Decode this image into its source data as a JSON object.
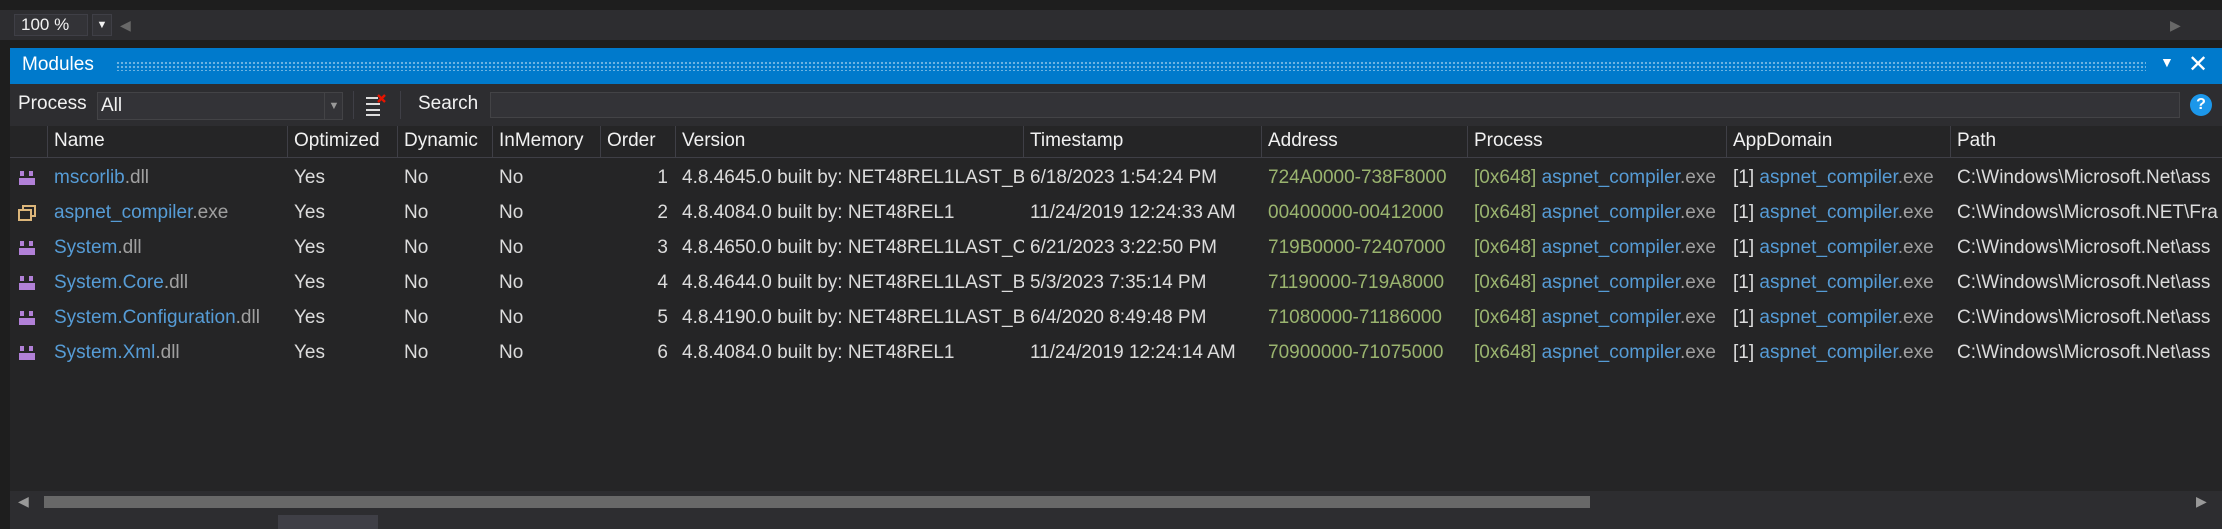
{
  "zoom": {
    "value": "100 %"
  },
  "panel": {
    "title": "Modules"
  },
  "toolbar": {
    "process_label": "Process",
    "process_value": "All",
    "search_label": "Search",
    "search_value": ""
  },
  "columns": [
    "Name",
    "Optimized",
    "Dynamic",
    "InMemory",
    "Order",
    "Version",
    "Timestamp",
    "Address",
    "Process",
    "AppDomain",
    "Path"
  ],
  "rows": [
    {
      "icon": "assembly-icon",
      "name_base": "mscorlib",
      "name_ext": ".dll",
      "optimized": "Yes",
      "dynamic": "No",
      "inmemory": "No",
      "order": "1",
      "version": "4.8.4645.0 built by: NET48REL1LAST_B",
      "timestamp": "6/18/2023 1:54:24 PM",
      "address": "724A0000-738F8000",
      "process_id": "[0x648]",
      "process_name": "aspnet_compiler",
      "process_ext": ".exe",
      "appdomain_id": "[1]",
      "appdomain_name": "aspnet_compiler",
      "appdomain_ext": ".exe",
      "path": "C:\\Windows\\Microsoft.Net\\ass"
    },
    {
      "icon": "executable-icon",
      "name_base": "aspnet_compiler",
      "name_ext": ".exe",
      "optimized": "Yes",
      "dynamic": "No",
      "inmemory": "No",
      "order": "2",
      "version": "4.8.4084.0 built by: NET48REL1",
      "timestamp": "11/24/2019 12:24:33 AM",
      "address": "00400000-00412000",
      "process_id": "[0x648]",
      "process_name": "aspnet_compiler",
      "process_ext": ".exe",
      "appdomain_id": "[1]",
      "appdomain_name": "aspnet_compiler",
      "appdomain_ext": ".exe",
      "path": "C:\\Windows\\Microsoft.NET\\Fra"
    },
    {
      "icon": "assembly-icon",
      "name_base": "System",
      "name_ext": ".dll",
      "optimized": "Yes",
      "dynamic": "No",
      "inmemory": "No",
      "order": "3",
      "version": "4.8.4650.0 built by: NET48REL1LAST_C",
      "timestamp": "6/21/2023 3:22:50 PM",
      "address": "719B0000-72407000",
      "process_id": "[0x648]",
      "process_name": "aspnet_compiler",
      "process_ext": ".exe",
      "appdomain_id": "[1]",
      "appdomain_name": "aspnet_compiler",
      "appdomain_ext": ".exe",
      "path": "C:\\Windows\\Microsoft.Net\\ass"
    },
    {
      "icon": "assembly-icon",
      "name_base": "System.Core",
      "name_ext": ".dll",
      "optimized": "Yes",
      "dynamic": "No",
      "inmemory": "No",
      "order": "4",
      "version": "4.8.4644.0 built by: NET48REL1LAST_B",
      "timestamp": "5/3/2023 7:35:14 PM",
      "address": "71190000-719A8000",
      "process_id": "[0x648]",
      "process_name": "aspnet_compiler",
      "process_ext": ".exe",
      "appdomain_id": "[1]",
      "appdomain_name": "aspnet_compiler",
      "appdomain_ext": ".exe",
      "path": "C:\\Windows\\Microsoft.Net\\ass"
    },
    {
      "icon": "assembly-icon",
      "name_base": "System.Configuration",
      "name_ext": ".dll",
      "optimized": "Yes",
      "dynamic": "No",
      "inmemory": "No",
      "order": "5",
      "version": "4.8.4190.0 built by: NET48REL1LAST_B",
      "timestamp": "6/4/2020 8:49:48 PM",
      "address": "71080000-71186000",
      "process_id": "[0x648]",
      "process_name": "aspnet_compiler",
      "process_ext": ".exe",
      "appdomain_id": "[1]",
      "appdomain_name": "aspnet_compiler",
      "appdomain_ext": ".exe",
      "path": "C:\\Windows\\Microsoft.Net\\ass"
    },
    {
      "icon": "assembly-icon",
      "name_base": "System.Xml",
      "name_ext": ".dll",
      "optimized": "Yes",
      "dynamic": "No",
      "inmemory": "No",
      "order": "6",
      "version": "4.8.4084.0 built by: NET48REL1",
      "timestamp": "11/24/2019 12:24:14 AM",
      "address": "70900000-71075000",
      "process_id": "[0x648]",
      "process_name": "aspnet_compiler",
      "process_ext": ".exe",
      "appdomain_id": "[1]",
      "appdomain_name": "aspnet_compiler",
      "appdomain_ext": ".exe",
      "path": "C:\\Windows\\Microsoft.Net\\ass"
    }
  ],
  "colors": {
    "accent": "#007acc",
    "link": "#569cd6",
    "address": "#b5cea8",
    "background": "#252526"
  }
}
